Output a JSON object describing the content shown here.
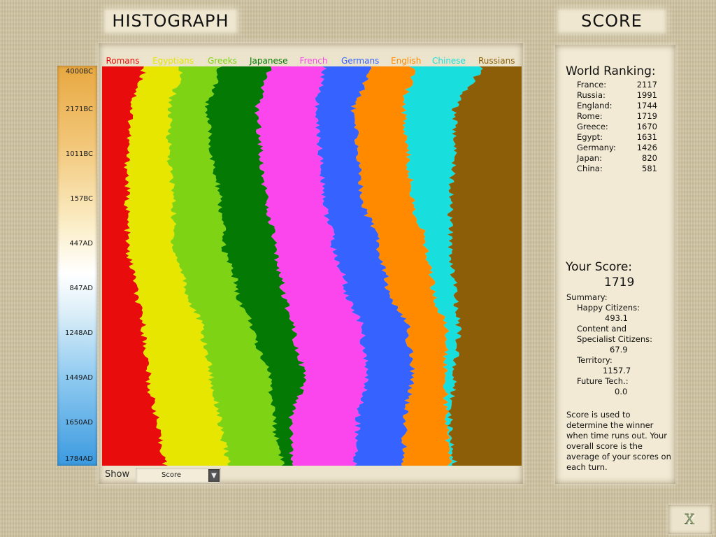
{
  "header": {
    "title": "HISTOGRAPH",
    "score_title": "SCORE"
  },
  "timeline": {
    "labels": [
      "4000BC",
      "2171BC",
      "1011BC",
      "157BC",
      "447AD",
      "847AD",
      "1248AD",
      "1449AD",
      "1650AD",
      "1784AD"
    ]
  },
  "show": {
    "label": "Show",
    "selected": "Score"
  },
  "ranking": {
    "title": "World Ranking:",
    "rows": [
      {
        "name": "France:",
        "score": "2117"
      },
      {
        "name": "Russia:",
        "score": "1991"
      },
      {
        "name": "England:",
        "score": "1744"
      },
      {
        "name": "Rome:",
        "score": "1719"
      },
      {
        "name": "Greece:",
        "score": "1670"
      },
      {
        "name": "Egypt:",
        "score": "1631"
      },
      {
        "name": "Germany:",
        "score": "1426"
      },
      {
        "name": "Japan:",
        "score": "820"
      },
      {
        "name": "China:",
        "score": "581"
      }
    ]
  },
  "your_score": {
    "title": "Your Score:",
    "value": "1719",
    "summary_label": "Summary:",
    "happy_label": "Happy Citizens:",
    "happy_value": "493.1",
    "content_label_1": "Content and",
    "content_label_2": "Specialist Citizens:",
    "content_value": "67.9",
    "territory_label": "Territory:",
    "territory_value": "1157.7",
    "future_label": "Future Tech.:",
    "future_value": "0.0"
  },
  "note": "Score is used to determine the winner when time runs out. Your overall score is the average of your scores on each turn.",
  "close": {
    "label": "X"
  },
  "colors": {
    "Romans": "#e80c0c",
    "Egyptians": "#e6e600",
    "Greeks": "#7ed414",
    "Japanese": "#047a04",
    "French": "#fb46ee",
    "Germans": "#3663ff",
    "English": "#ff8a00",
    "Chinese": "#18dedd",
    "Russians": "#8c5e08"
  },
  "chart_data": {
    "type": "area",
    "stacked": true,
    "orientation": "vertical-time",
    "series": [
      {
        "name": "Romans"
      },
      {
        "name": "Egyptians"
      },
      {
        "name": "Greeks"
      },
      {
        "name": "Japanese"
      },
      {
        "name": "French"
      },
      {
        "name": "Germans"
      },
      {
        "name": "English"
      },
      {
        "name": "Chinese"
      },
      {
        "name": "Russians"
      }
    ],
    "time_labels": [
      "4000BC",
      "2171BC",
      "1011BC",
      "157BC",
      "447AD",
      "847AD",
      "1248AD",
      "1449AD",
      "1650AD",
      "1784AD"
    ],
    "boundaries_fraction": [
      [
        0.1,
        0.19,
        0.28,
        0.4,
        0.53,
        0.64,
        0.74,
        0.9
      ],
      [
        0.07,
        0.16,
        0.25,
        0.37,
        0.51,
        0.6,
        0.72,
        0.84
      ],
      [
        0.06,
        0.16,
        0.26,
        0.38,
        0.52,
        0.61,
        0.73,
        0.84
      ],
      [
        0.06,
        0.17,
        0.28,
        0.39,
        0.53,
        0.62,
        0.74,
        0.83
      ],
      [
        0.06,
        0.17,
        0.29,
        0.41,
        0.55,
        0.66,
        0.77,
        0.83
      ],
      [
        0.08,
        0.2,
        0.32,
        0.43,
        0.58,
        0.68,
        0.79,
        0.84
      ],
      [
        0.1,
        0.24,
        0.36,
        0.46,
        0.62,
        0.73,
        0.82,
        0.85
      ],
      [
        0.11,
        0.26,
        0.4,
        0.48,
        0.63,
        0.74,
        0.82,
        0.84
      ],
      [
        0.13,
        0.28,
        0.41,
        0.45,
        0.61,
        0.72,
        0.82,
        0.83
      ],
      [
        0.15,
        0.3,
        0.43,
        0.45,
        0.6,
        0.72,
        0.83,
        0.84
      ]
    ]
  }
}
